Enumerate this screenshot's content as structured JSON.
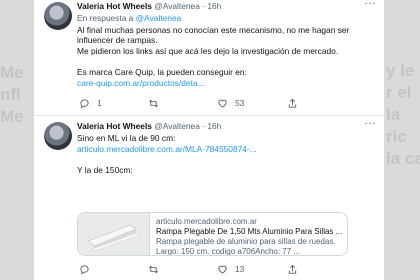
{
  "background": {
    "left_lines": [
      "Me",
      "nfl",
      "Me"
    ],
    "right_lines": [
      "y le",
      "r el",
      "la",
      "ric",
      "ia ca"
    ]
  },
  "tweets": [
    {
      "author": {
        "name": "Valeria Hot Wheels",
        "handle": "@Avaltenea",
        "separator": "·",
        "time": "16h"
      },
      "more_label": "···",
      "reply": {
        "prefix": "En respuesta a",
        "mention": "@Avaltenea"
      },
      "lines": [
        "Al final muchas personas no conocían este mecanismo, no me hagan ser",
        "influencer de rampas.",
        "Me pidieron los links así que acá les dejo la investigación de mercado.",
        "",
        "Es marca Care Quip, la pueden conseguir en:"
      ],
      "link": "care-quip.com.ar/productos/deta...",
      "actions": {
        "reply_count": "1",
        "retweet_count": "",
        "like_count": "53",
        "share_count": ""
      }
    },
    {
      "author": {
        "name": "Valeria Hot Wheels",
        "handle": "@Avaltenea",
        "separator": "·",
        "time": "16h"
      },
      "more_label": "···",
      "lines_before_link": [
        "Sino en ML vi la de 90 cm:"
      ],
      "link": "articulo.mercadolibre.com.ar/MLA-784550874-...",
      "lines_after_link": [
        "Y la de 150cm:"
      ],
      "card": {
        "domain": "articulo.mercadolibre.com.ar",
        "title": "Rampa Plegable De 1,50 Mts Aluminio Para Sillas ...",
        "description": "Rampa plegable de aluminio para sillas de ruedas. Largo: 150 cm. codigo a706Ancho: 77 ..."
      },
      "actions": {
        "reply_count": "",
        "retweet_count": "",
        "like_count": "13",
        "share_count": ""
      }
    }
  ]
}
